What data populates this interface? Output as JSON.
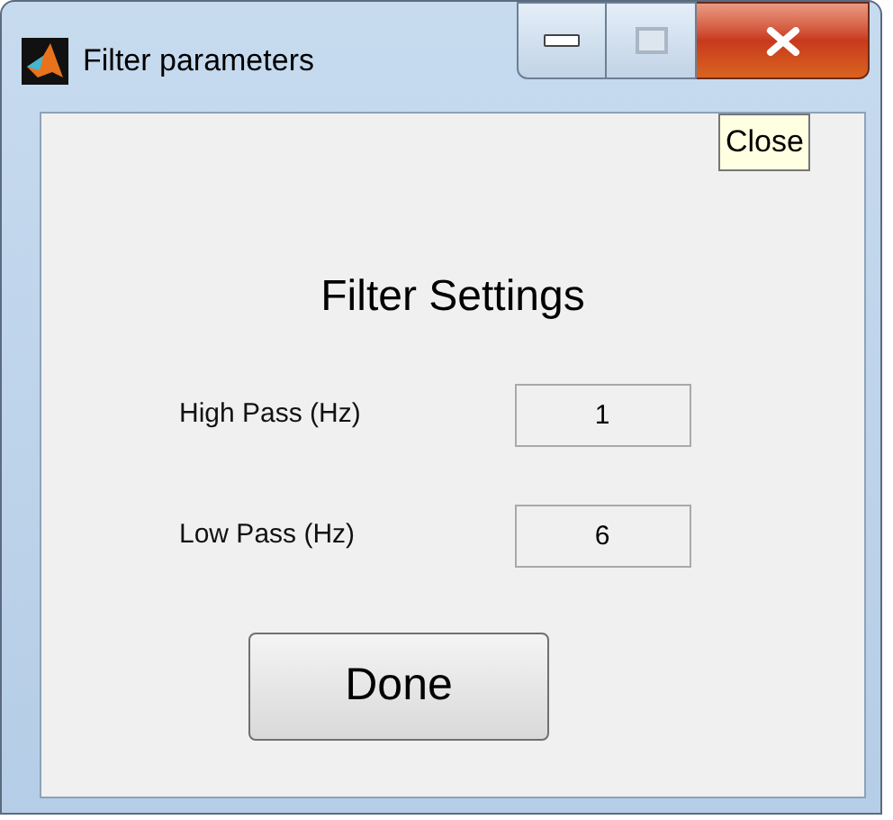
{
  "window": {
    "title": "Filter parameters"
  },
  "tooltip": "Close",
  "heading": "Filter Settings",
  "fields": [
    {
      "label": "High Pass (Hz)",
      "value": "1"
    },
    {
      "label": "Low Pass (Hz)",
      "value": "6"
    }
  ],
  "button": "Done"
}
